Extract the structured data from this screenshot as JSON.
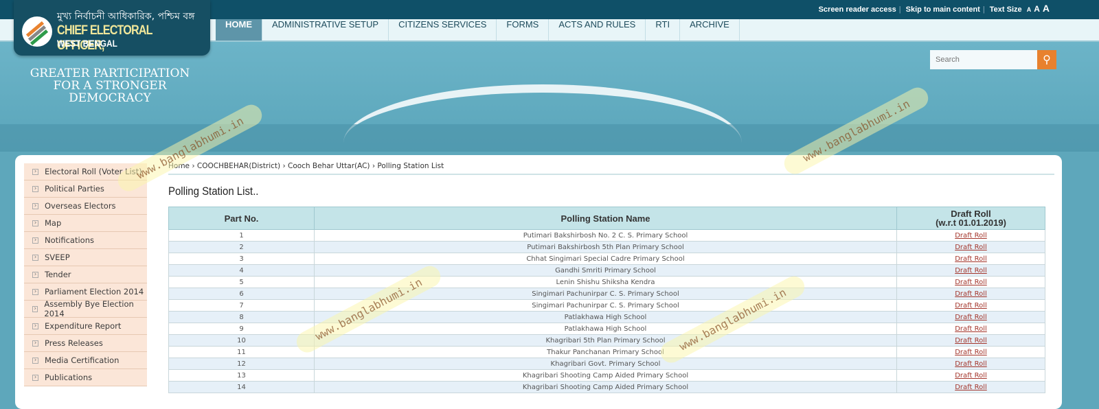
{
  "utility": {
    "screen_reader": "Screen reader access",
    "skip": "Skip to main content",
    "text_size": "Text Size",
    "sizes": [
      "A",
      "A",
      "A"
    ]
  },
  "logo": {
    "bengali": "মুখ্য নির্বাচনী আধিকারিক, পশ্চিম বঙ্গ",
    "title": "CHIEF ELECTORAL OFFICER,",
    "subtitle": "WEST BENGAL"
  },
  "nav": [
    "HOME",
    "ADMINISTRATIVE SETUP",
    "CITIZENS SERVICES",
    "FORMS",
    "ACTS AND RULES",
    "RTI",
    "ARCHIVE"
  ],
  "tagline": "GREATER PARTICIPATION FOR A STRONGER DEMOCRACY",
  "search": {
    "placeholder": "Search",
    "icon": "search-icon"
  },
  "sidebar": [
    "Electoral Roll (Voter List)",
    "Political Parties",
    "Overseas Electors",
    "Map",
    "Notifications",
    "SVEEP",
    "Tender",
    "Parliament Election 2014",
    "Assembly Bye Election 2014",
    "Expenditure Report",
    "Press Releases",
    "Media Certification",
    "Publications"
  ],
  "breadcrumb": [
    "Home",
    "COOCHBEHAR(District)",
    "Cooch Behar Uttar(AC)",
    "Polling Station List"
  ],
  "page_title": "Polling Station List..",
  "table": {
    "headers": [
      "Part No.",
      "Polling Station Name",
      "Draft Roll",
      "(w.r.t 01.01.2019)"
    ],
    "link_label": "Draft Roll",
    "rows": [
      [
        "1",
        "Putimari Bakshirbosh No. 2 C. S. Primary School"
      ],
      [
        "2",
        "Putimari Bakshirbosh 5th Plan Primary School"
      ],
      [
        "3",
        "Chhat Singimari Special Cadre Primary School"
      ],
      [
        "4",
        "Gandhi Smriti Primary School"
      ],
      [
        "5",
        "Lenin Shishu Shiksha Kendra"
      ],
      [
        "6",
        "Singimari Pachunirpar C. S. Primary School"
      ],
      [
        "7",
        "Singimari Pachunirpar C. S. Primary School"
      ],
      [
        "8",
        "Patlakhawa High School"
      ],
      [
        "9",
        "Patlakhawa High School"
      ],
      [
        "10",
        "Khagribari 5th Plan Primary School"
      ],
      [
        "11",
        "Thakur Panchanan Primary School"
      ],
      [
        "12",
        "Khagribari Govt. Primary School"
      ],
      [
        "13",
        "Khagribari Shooting Camp Aided Primary School"
      ],
      [
        "14",
        "Khagribari Shooting Camp Aided Primary School"
      ]
    ]
  },
  "watermark": "www.banglabhumi.in",
  "colors": {
    "topbar": "#0f5068",
    "accent": "#e8812e",
    "sidebar": "#fbe6d8",
    "table_header": "#c4e4e8",
    "link": "#a3342a"
  }
}
